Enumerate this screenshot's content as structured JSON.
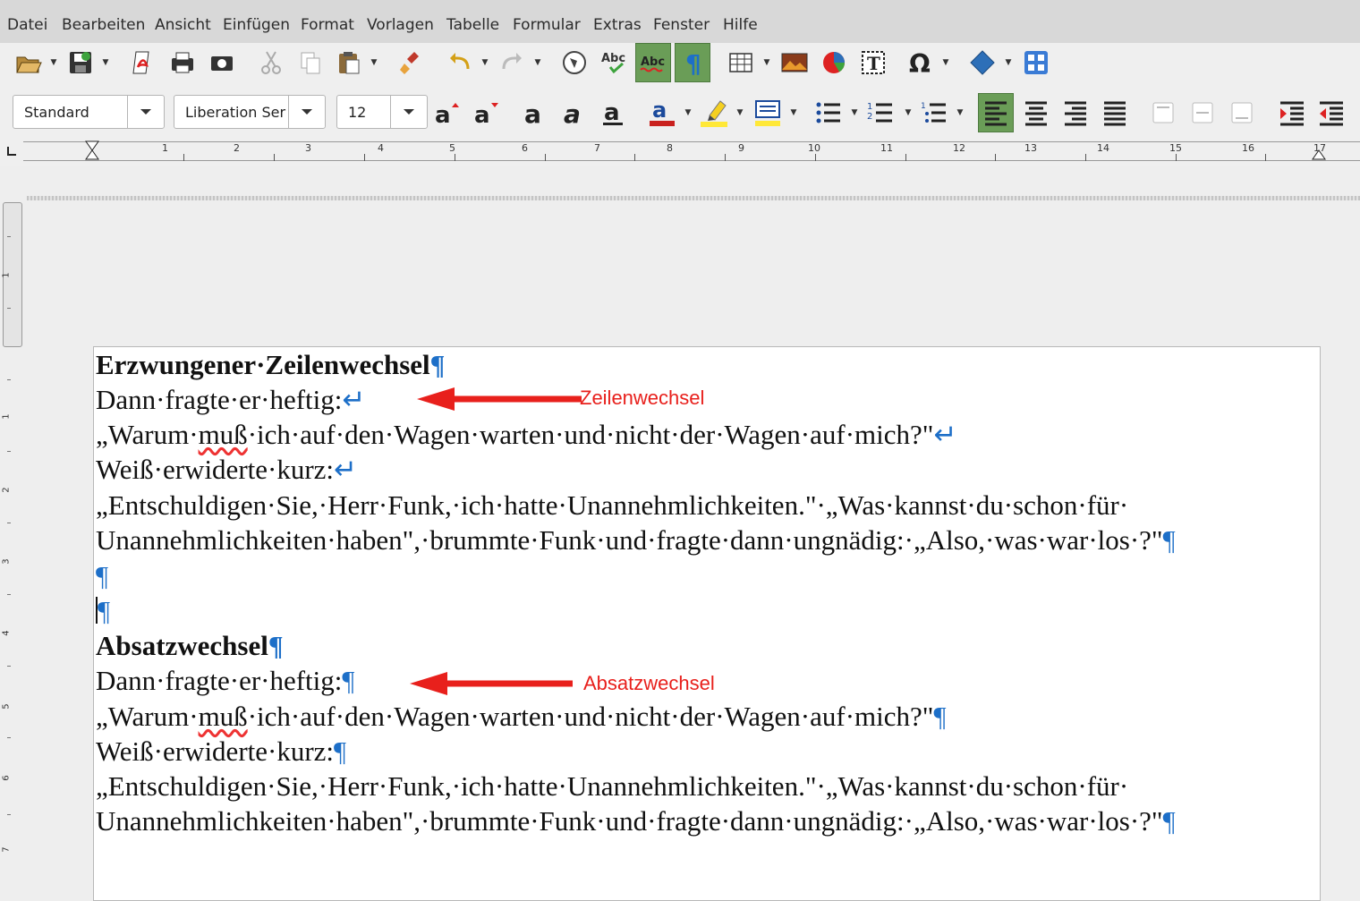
{
  "menubar": {
    "items": [
      "Datei",
      "Bearbeiten",
      "Ansicht",
      "Einfügen",
      "Format",
      "Vorlagen",
      "Tabelle",
      "Formular",
      "Extras",
      "Fenster",
      "Hilfe"
    ]
  },
  "formatting": {
    "paragraph_style": "Standard",
    "font_name": "Liberation Ser",
    "font_size": "12"
  },
  "ruler": {
    "numbers": [
      "1",
      "2",
      "3",
      "4",
      "5",
      "6",
      "7",
      "8",
      "9",
      "10",
      "11",
      "12",
      "13",
      "14",
      "15",
      "16",
      "17"
    ],
    "vertical_numbers": [
      "1",
      "1",
      "2",
      "3",
      "4",
      "5",
      "6",
      "7"
    ]
  },
  "document": {
    "heading1": "Erzwungener·Zeilenwechsel",
    "heading2": "Absatzwechsel",
    "line_dann": "Dann·fragte·er·heftig:",
    "line_warum_a": "„Warum·",
    "line_warum_muss": "muß",
    "line_warum_b": "·ich·auf·den·Wagen·warten·und·nicht·der·Wagen·auf·mich?\"",
    "line_weiss": "Weiß·erwiderte·kurz:",
    "line_entsch": "„Entschuldigen·Sie,·Herr·Funk,·ich·hatte·Unannehmlichkeiten.\"·„Was·kannst·du·schon·für·",
    "line_unann": "Unannehmlichkeiten·haben\",·brummte·Funk·und·fragte·dann·ungnädig:·„Also,·was·war·los·?\"",
    "pilcrow": "¶",
    "line_break_mark": "↵"
  },
  "annotations": {
    "line_break": "Zeilenwechsel",
    "paragraph_break": "Absatzwechsel",
    "arrow_color": "#e8201c"
  },
  "colors": {
    "formatting_marks": "#1d6fc8",
    "active_button": "#6a9d57",
    "spellcheck": "#e33333"
  }
}
